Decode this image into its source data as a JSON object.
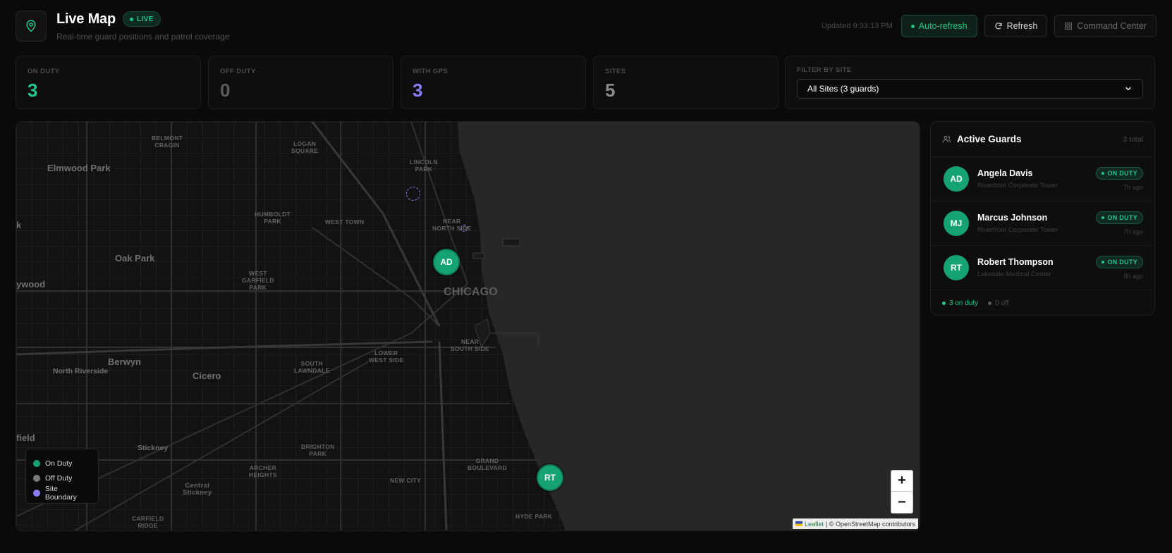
{
  "header": {
    "title": "Live Map",
    "live_badge": "LIVE",
    "subtitle": "Real-time guard positions and patrol coverage",
    "updated": "Updated 9:33:13 PM",
    "auto_refresh_label": "Auto-refresh",
    "refresh_label": "Refresh",
    "command_center_label": "Command Center"
  },
  "stats": [
    {
      "label": "ON DUTY",
      "value": "3",
      "color": "#22c58b"
    },
    {
      "label": "OFF DUTY",
      "value": "0",
      "color": "#5a5a5a"
    },
    {
      "label": "WITH GPS",
      "value": "3",
      "color": "#8b7cf6"
    },
    {
      "label": "SITES",
      "value": "5",
      "color": "#8a8a8a"
    }
  ],
  "filter": {
    "label": "FILTER BY SITE",
    "selected": "All Sites (3 guards)"
  },
  "map": {
    "labels": {
      "belmont_cragin": "BELMONT\nCRAGIN",
      "logan_square": "LOGAN\nSQUARE",
      "lincoln_park": "LINCOLN\nPARK",
      "elmwood_park": "Elmwood Park",
      "humboldt_park": "HUMBOLDT\nPARK",
      "west_town": "WEST TOWN",
      "near_north_side": "NEAR\nNORTH SIDE",
      "oak_park": "Oak Park",
      "west_garfield_park": "WEST\nGARFIELD\nPARK",
      "chicago": "CHICAGO",
      "ywood": "ywood",
      "k": "k",
      "near_south_side": "NEAR\nSOUTH SIDE",
      "lower_west_side": "LOWER\nWEST SIDE",
      "south_lawndale": "SOUTH\nLAWNDALE",
      "north_riverside": "North Riverside",
      "berwyn": "Berwyn",
      "cicero": "Cicero",
      "field": "field",
      "stickney": "Stickney",
      "brighton_park": "BRIGHTON\nPARK",
      "grand_boulevard": "GRAND\nBOULEVARD",
      "archer_heights": "ARCHER\nHEIGHTS",
      "new_city": "NEW CITY",
      "central_stickney": "Central\nStickney",
      "hyde_park": "HYDE PARK",
      "carfield_ridge": "CARFIELD\nRIDGE"
    },
    "markers": [
      {
        "initials": "AD"
      },
      {
        "initials": "RT"
      }
    ],
    "legend": [
      {
        "label": "On Duty",
        "color": "#16a374"
      },
      {
        "label": "Off Duty",
        "color": "#7a7a7a"
      },
      {
        "label": "Site Boundary",
        "color": "#8b7cf6"
      }
    ],
    "zoom_in": "+",
    "zoom_out": "−",
    "attribution_leaflet": "Leaflet",
    "attribution_rest": "| © OpenStreetMap contributors"
  },
  "guards_panel": {
    "title": "Active Guards",
    "count": "3 total",
    "guards": [
      {
        "initials": "AD",
        "name": "Angela Davis",
        "site": "Riverfront Corporate Tower",
        "status": "ON DUTY",
        "time": "7h ago"
      },
      {
        "initials": "MJ",
        "name": "Marcus Johnson",
        "site": "Riverfront Corporate Tower",
        "status": "ON DUTY",
        "time": "7h ago"
      },
      {
        "initials": "RT",
        "name": "Robert Thompson",
        "site": "Lakeside Medical Center",
        "status": "ON DUTY",
        "time": "8h ago"
      }
    ],
    "footer_on": "3 on duty",
    "footer_off": "0 off"
  }
}
